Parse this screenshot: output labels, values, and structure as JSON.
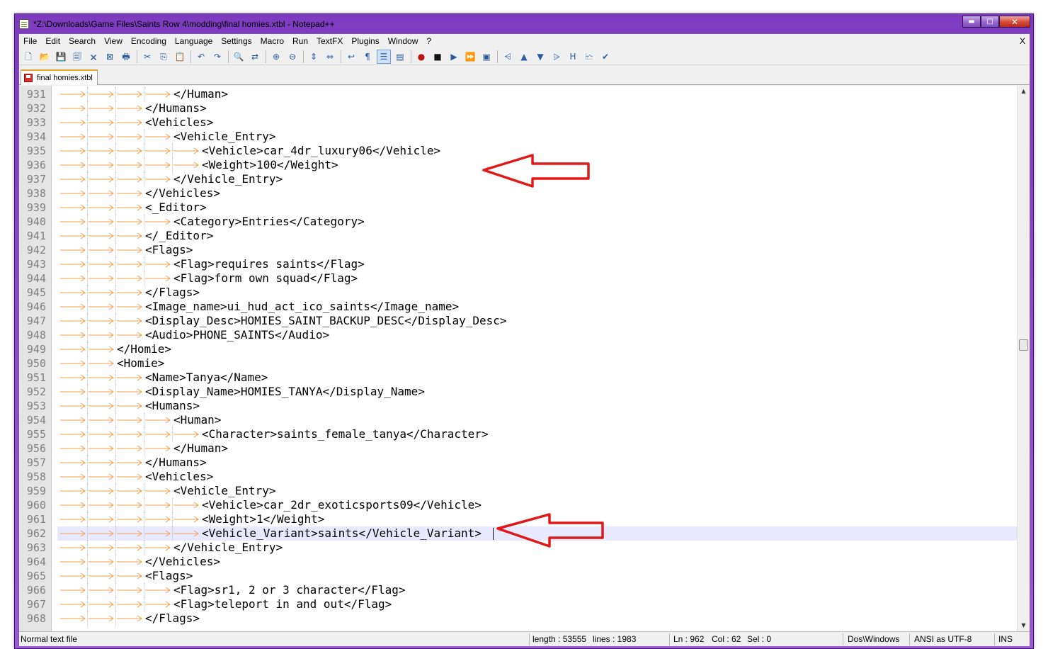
{
  "window": {
    "title": "*Z:\\Downloads\\Game Files\\Saints Row 4\\modding\\final homies.xtbl - Notepad++",
    "minimize_glyph": "▬",
    "maximize_glyph": "□",
    "close_glyph": "✕"
  },
  "menu": {
    "items": [
      "File",
      "Edit",
      "Search",
      "View",
      "Encoding",
      "Language",
      "Settings",
      "Macro",
      "Run",
      "TextFX",
      "Plugins",
      "Window",
      "?"
    ],
    "close_doc": "X"
  },
  "toolbar": {
    "icons": [
      {
        "name": "new-file-icon",
        "glyph": "🗋"
      },
      {
        "name": "open-file-icon",
        "glyph": "📂"
      },
      {
        "name": "save-icon",
        "glyph": "💾"
      },
      {
        "name": "save-all-icon",
        "glyph": "🗐"
      },
      {
        "name": "close-file-icon",
        "glyph": "🗙"
      },
      {
        "name": "close-all-icon",
        "glyph": "⊠"
      },
      {
        "name": "print-icon",
        "glyph": "🖶"
      },
      {
        "name": "sep"
      },
      {
        "name": "cut-icon",
        "glyph": "✂"
      },
      {
        "name": "copy-icon",
        "glyph": "⎘"
      },
      {
        "name": "paste-icon",
        "glyph": "📋"
      },
      {
        "name": "sep"
      },
      {
        "name": "undo-icon",
        "glyph": "↶"
      },
      {
        "name": "redo-icon",
        "glyph": "↷"
      },
      {
        "name": "sep"
      },
      {
        "name": "find-icon",
        "glyph": "🔍"
      },
      {
        "name": "replace-icon",
        "glyph": "⇄"
      },
      {
        "name": "sep"
      },
      {
        "name": "zoom-in-icon",
        "glyph": "⊕"
      },
      {
        "name": "zoom-out-icon",
        "glyph": "⊖"
      },
      {
        "name": "sep"
      },
      {
        "name": "sync-vertical-icon",
        "glyph": "⇕"
      },
      {
        "name": "sync-horizontal-icon",
        "glyph": "⇔"
      },
      {
        "name": "sep"
      },
      {
        "name": "word-wrap-icon",
        "glyph": "↩"
      },
      {
        "name": "show-all-chars-icon",
        "glyph": "¶"
      },
      {
        "name": "indent-guide-icon",
        "glyph": "☰",
        "active": true
      },
      {
        "name": "language-udl-icon",
        "glyph": "▤"
      },
      {
        "name": "sep"
      },
      {
        "name": "record-macro-icon",
        "glyph": "●",
        "cls": "rec"
      },
      {
        "name": "stop-macro-icon",
        "glyph": "■",
        "cls": "blk"
      },
      {
        "name": "play-macro-icon",
        "glyph": "▶"
      },
      {
        "name": "play-multiple-icon",
        "glyph": "⏩"
      },
      {
        "name": "save-macro-icon",
        "glyph": "▣"
      },
      {
        "name": "sep"
      },
      {
        "name": "xml-tools-icon",
        "glyph": "⩤"
      },
      {
        "name": "arrow-up-icon",
        "glyph": "▲"
      },
      {
        "name": "arrow-down-icon",
        "glyph": "▼"
      },
      {
        "name": "collapse-icon",
        "glyph": "⩥"
      },
      {
        "name": "html-tidy-icon",
        "glyph": "H"
      },
      {
        "name": "plugin-icon",
        "glyph": "🗠"
      },
      {
        "name": "spell-check-icon",
        "glyph": "✔"
      }
    ]
  },
  "tab": {
    "label": "final homies.xtbl"
  },
  "editor": {
    "current_line": 962,
    "lines": [
      {
        "n": "931",
        "d": 4,
        "t": "</Human>"
      },
      {
        "n": "932",
        "d": 3,
        "t": "</Humans>"
      },
      {
        "n": "933",
        "d": 3,
        "t": "<Vehicles>"
      },
      {
        "n": "934",
        "d": 4,
        "t": "<Vehicle_Entry>"
      },
      {
        "n": "935",
        "d": 5,
        "t": "<Vehicle>car_4dr_luxury06</Vehicle>"
      },
      {
        "n": "936",
        "d": 5,
        "t": "<Weight>100</Weight>"
      },
      {
        "n": "937",
        "d": 4,
        "t": "</Vehicle_Entry>"
      },
      {
        "n": "938",
        "d": 3,
        "t": "</Vehicles>"
      },
      {
        "n": "939",
        "d": 3,
        "t": "<_Editor>"
      },
      {
        "n": "940",
        "d": 4,
        "t": "<Category>Entries</Category>"
      },
      {
        "n": "941",
        "d": 3,
        "t": "</_Editor>"
      },
      {
        "n": "942",
        "d": 3,
        "t": "<Flags>"
      },
      {
        "n": "943",
        "d": 4,
        "t": "<Flag>requires saints</Flag>"
      },
      {
        "n": "944",
        "d": 4,
        "t": "<Flag>form own squad</Flag>"
      },
      {
        "n": "945",
        "d": 3,
        "t": "</Flags>"
      },
      {
        "n": "946",
        "d": 3,
        "t": "<Image_name>ui_hud_act_ico_saints</Image_name>"
      },
      {
        "n": "947",
        "d": 3,
        "t": "<Display_Desc>HOMIES_SAINT_BACKUP_DESC</Display_Desc>"
      },
      {
        "n": "948",
        "d": 3,
        "t": "<Audio>PHONE_SAINTS</Audio>"
      },
      {
        "n": "949",
        "d": 2,
        "t": "</Homie>"
      },
      {
        "n": "950",
        "d": 2,
        "t": "<Homie>"
      },
      {
        "n": "951",
        "d": 3,
        "t": "<Name>Tanya</Name>"
      },
      {
        "n": "952",
        "d": 3,
        "t": "<Display_Name>HOMIES_TANYA</Display_Name>"
      },
      {
        "n": "953",
        "d": 3,
        "t": "<Humans>"
      },
      {
        "n": "954",
        "d": 4,
        "t": "<Human>"
      },
      {
        "n": "955",
        "d": 5,
        "t": "<Character>saints_female_tanya</Character>"
      },
      {
        "n": "956",
        "d": 4,
        "t": "</Human>"
      },
      {
        "n": "957",
        "d": 3,
        "t": "</Humans>"
      },
      {
        "n": "958",
        "d": 3,
        "t": "<Vehicles>"
      },
      {
        "n": "959",
        "d": 4,
        "t": "<Vehicle_Entry>"
      },
      {
        "n": "960",
        "d": 5,
        "t": "<Vehicle>car_2dr_exoticsports09</Vehicle>"
      },
      {
        "n": "961",
        "d": 5,
        "t": "<Weight>1</Weight>"
      },
      {
        "n": "962",
        "d": 5,
        "t": "<Vehicle_Variant>saints</Vehicle_Variant>"
      },
      {
        "n": "963",
        "d": 4,
        "t": "</Vehicle_Entry>"
      },
      {
        "n": "964",
        "d": 3,
        "t": "</Vehicles>"
      },
      {
        "n": "965",
        "d": 3,
        "t": "<Flags>"
      },
      {
        "n": "966",
        "d": 4,
        "t": "<Flag>sr1, 2 or 3 character</Flag>"
      },
      {
        "n": "967",
        "d": 4,
        "t": "<Flag>teleport in and out</Flag>"
      },
      {
        "n": "968",
        "d": 3,
        "t": "</Flags>"
      }
    ]
  },
  "status": {
    "file_type": "Normal text file",
    "length": "length : 53555",
    "lines": "lines : 1983",
    "ln": "Ln : 962",
    "col": "Col : 62",
    "sel": "Sel : 0",
    "eol": "Dos\\Windows",
    "encoding": "ANSI as UTF-8",
    "mode": "INS"
  },
  "colors": {
    "tab_arrow": "#f0a050",
    "current_line_bg": "#e8e8ff",
    "annotation_arrow": "#e01818",
    "title_bar": "#8a47cb"
  }
}
